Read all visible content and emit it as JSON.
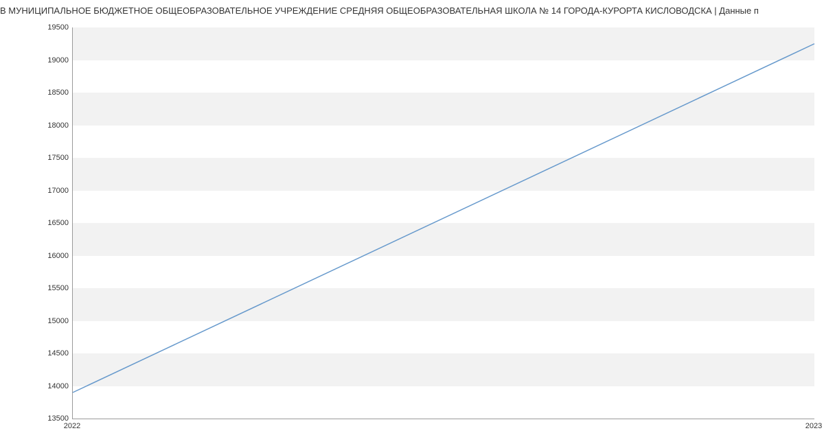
{
  "chart_data": {
    "type": "line",
    "title": "В МУНИЦИПАЛЬНОЕ БЮДЖЕТНОЕ ОБЩЕОБРАЗОВАТЕЛЬНОЕ УЧРЕЖДЕНИЕ СРЕДНЯЯ ОБЩЕОБРАЗОВАТЕЛЬНАЯ ШКОЛА № 14 ГОРОДА-КУРОРТА КИСЛОВОДСКА | Данные п",
    "x": [
      2022,
      2023
    ],
    "series": [
      {
        "name": "",
        "values": [
          13900,
          19250
        ]
      }
    ],
    "xlabel": "",
    "ylabel": "",
    "xlim": [
      2022,
      2023
    ],
    "ylim": [
      13500,
      19500
    ],
    "y_ticks": [
      13500,
      14000,
      14500,
      15000,
      15500,
      16000,
      16500,
      17000,
      17500,
      18000,
      18500,
      19000,
      19500
    ],
    "x_ticks": [
      2022,
      2023
    ],
    "line_color": "#6699cc"
  }
}
